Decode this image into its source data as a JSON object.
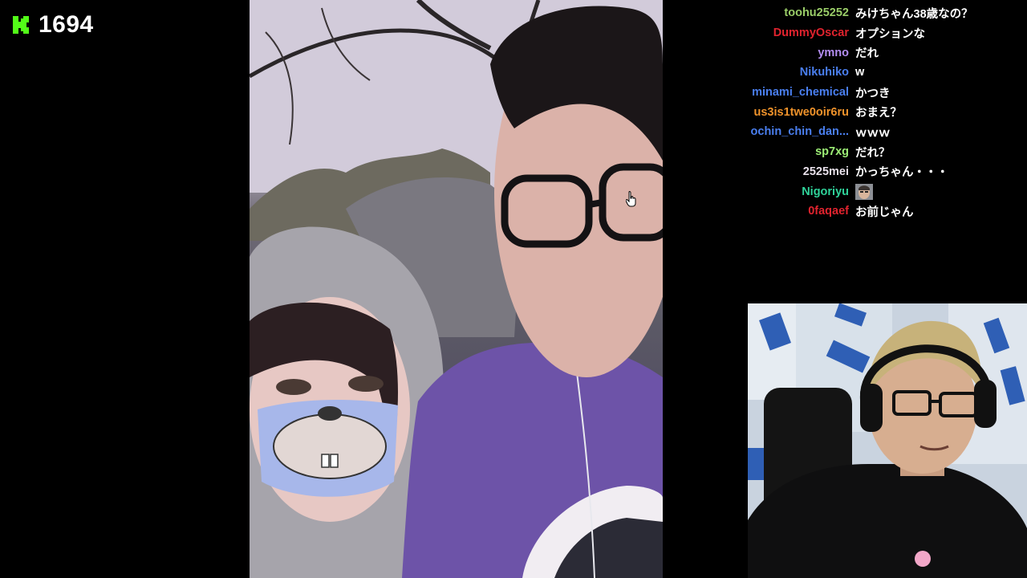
{
  "stream": {
    "viewer_count": "1694",
    "brand_color": "#53fc18"
  },
  "chat": {
    "messages": [
      {
        "user": "toohu25252",
        "color": "#9acd68",
        "text": "みけちゃん38歳なの？"
      },
      {
        "user": "DummyOscar",
        "color": "#e0232e",
        "text": "オプションな"
      },
      {
        "user": "ymno",
        "color": "#b38df0",
        "text": "だれ"
      },
      {
        "user": "Nikuhiko",
        "color": "#4a7ff0",
        "text": "w"
      },
      {
        "user": "minami_chemical",
        "color": "#4a7ff0",
        "text": "かつき"
      },
      {
        "user": "us3is1twe0oir6ru",
        "color": "#f0932b",
        "text": "おまえ？"
      },
      {
        "user": "ochin_chin_dan...",
        "color": "#4a7ff0",
        "text": "ｗｗｗ"
      },
      {
        "user": "sp7xg",
        "color": "#9dee76",
        "text": "だれ？"
      },
      {
        "user": "2525mei",
        "color": "#e8e0ea",
        "text": "かっちゃん・・・"
      },
      {
        "user": "Nigoriyu",
        "color": "#2fd39a",
        "text": "",
        "emote": "face-emote-icon"
      },
      {
        "user": "0faqaef",
        "color": "#e0232e",
        "text": "お前じゃん"
      }
    ]
  }
}
